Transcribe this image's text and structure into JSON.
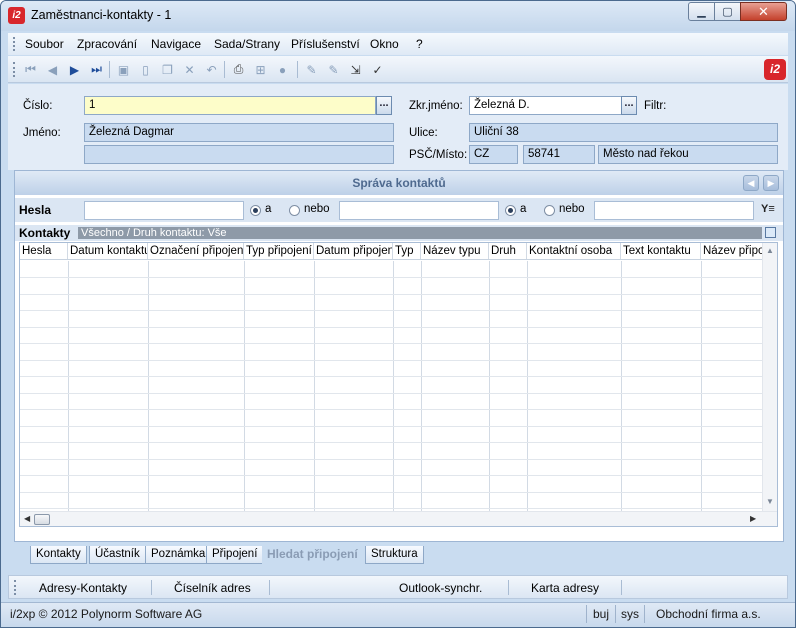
{
  "window": {
    "icon_text": "i2",
    "title": "Zaměstnanci-kontakty - 1",
    "min_glyph": "▁",
    "max_glyph": "▢",
    "close_glyph": "✕"
  },
  "menu": {
    "items": [
      "Soubor",
      "Zpracování",
      "Navigace",
      "Sada/Strany",
      "Příslušenství",
      "Okno",
      "?"
    ]
  },
  "toolbar": {
    "icons": [
      "first-record-icon",
      "prev-record-icon",
      "next-record-icon",
      "last-record-icon",
      "save-icon",
      "new-icon",
      "copy-icon",
      "delete-icon",
      "undo-icon",
      "print-icon",
      "tree-icon",
      "stop-icon",
      "edit-icon",
      "edit-disabled-icon",
      "import-icon",
      "filter-check-icon"
    ],
    "brand": "i2"
  },
  "form": {
    "cislo_label": "Číslo:",
    "cislo_value": "1",
    "jmeno_label": "Jméno:",
    "jmeno_value": "Železná Dagmar",
    "jmeno_value2": "",
    "zkr_label": "Zkr.jméno:",
    "zkr_value": "Železná D.",
    "filtr_label": "Filtr:",
    "ulice_label": "Ulice:",
    "ulice_value": "Uliční 38",
    "psc_label": "PSČ/Místo:",
    "country": "CZ",
    "psc": "58741",
    "misto": "Město nad řekou",
    "ellipsis": "..."
  },
  "panel": {
    "title": "Správa kontaktů",
    "nav_prev": "◀",
    "nav_next": "▶"
  },
  "filter": {
    "hesla_label": "Hesla",
    "input1": "",
    "a1_label": "a",
    "nebo1_label": "nebo",
    "input2": "",
    "a2_label": "a",
    "nebo2_label": "nebo",
    "input3": "",
    "filter_icon": "Y≡",
    "a1_selected": true,
    "a2_selected": true
  },
  "kontakty": {
    "label": "Kontakty",
    "strip_text": "Všechno / Druh kontaktu: Vše"
  },
  "grid": {
    "columns": [
      "Hesla",
      "Datum kontaktu",
      "Označení připojení",
      "Typ připojení",
      "Datum připojení",
      "Typ",
      "Název typu",
      "Druh",
      "Kontaktní osoba",
      "Text kontaktu",
      "Název připo"
    ],
    "rows": []
  },
  "tabs": [
    "Kontakty",
    "Účastník",
    "Poznámka",
    "Připojení",
    "Hledat připojení",
    "Struktura"
  ],
  "active_tab": "Hledat připojení",
  "bottom_bar": {
    "items": [
      "Adresy-Kontakty",
      "Číselník adres",
      "Outlook-synchr.",
      "Karta adresy"
    ]
  },
  "status": {
    "copyright": "i/2xp © 2012 Polynorm Software AG",
    "buj": "buj",
    "sys": "sys",
    "company": "Obchodní firma a.s."
  },
  "colors": {
    "accent": "#d8262b",
    "window_bg": "#c9dcf0",
    "field_bg": "#c9dbf0",
    "yellow_field": "#fdfdc9"
  }
}
